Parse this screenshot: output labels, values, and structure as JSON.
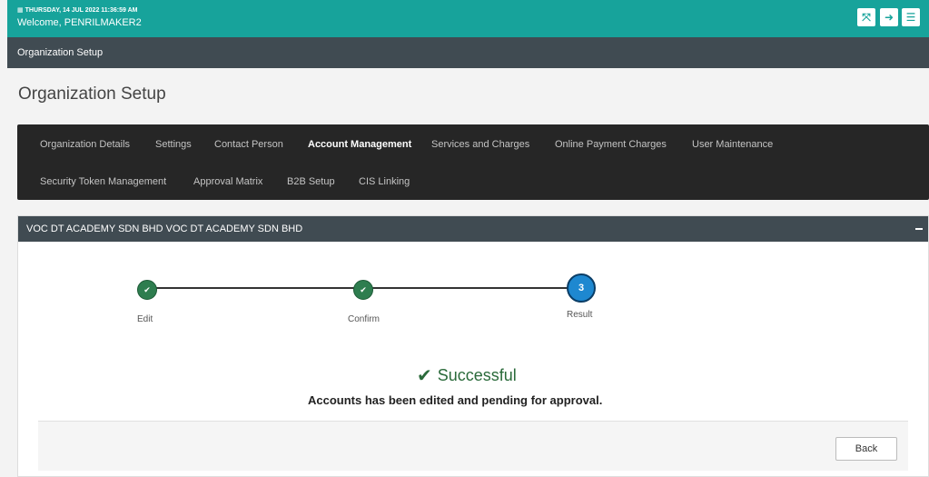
{
  "topbar": {
    "date": "THURSDAY, 14 JUL 2022 11:36:59 AM",
    "welcome": "Welcome, PENRILMAKER2",
    "buttons": [
      {
        "icon": "fullscreen-icon"
      },
      {
        "icon": "logout-icon"
      },
      {
        "icon": "menu-icon"
      }
    ],
    "color": "#17a39b"
  },
  "subbar": {
    "title": "Organization Setup"
  },
  "page": {
    "title": "Organization Setup"
  },
  "tabs": [
    {
      "label": "Organization Details",
      "active": false
    },
    {
      "label": "Settings",
      "active": false
    },
    {
      "label": "Contact Person",
      "active": false
    },
    {
      "label": "Account Management",
      "active": true
    },
    {
      "label": "Services and Charges",
      "active": false
    },
    {
      "label": "Online Payment Charges",
      "active": false
    },
    {
      "label": "User Maintenance",
      "active": false
    },
    {
      "label": "Security Token Management",
      "active": false
    },
    {
      "label": "Approval Matrix",
      "active": false
    },
    {
      "label": "B2B Setup",
      "active": false
    },
    {
      "label": "CIS Linking",
      "active": false
    }
  ],
  "panel": {
    "header": "VOC DT ACADEMY SDN BHD VOC DT ACADEMY SDN BHD",
    "steps": [
      {
        "label": "Edit",
        "state": "done",
        "mark": "✔"
      },
      {
        "label": "Confirm",
        "state": "done",
        "mark": "✔"
      },
      {
        "label": "Result",
        "state": "current",
        "mark": "3"
      }
    ],
    "result": {
      "title": "Successful",
      "message": "Accounts has been edited and pending for approval."
    },
    "back_label": "Back"
  }
}
